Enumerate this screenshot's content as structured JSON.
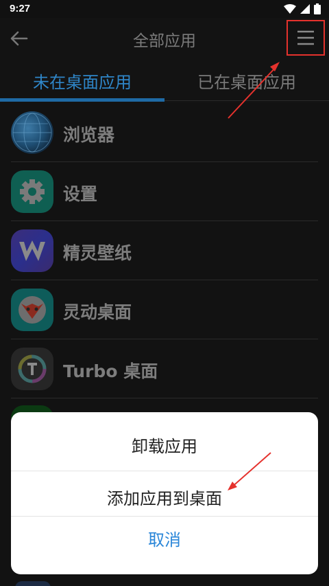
{
  "status_bar": {
    "time": "9:27"
  },
  "app_bar": {
    "title": "全部应用"
  },
  "tabs": [
    {
      "label": "未在桌面应用",
      "active": true
    },
    {
      "label": "已在桌面应用",
      "active": false
    }
  ],
  "apps": [
    {
      "name": "浏览器",
      "icon": "browser-globe-icon"
    },
    {
      "name": "设置",
      "icon": "settings-gear-icon"
    },
    {
      "name": "精灵壁纸",
      "icon": "wallpaper-w-icon"
    },
    {
      "name": "灵动桌面",
      "icon": "fox-launcher-icon"
    },
    {
      "name": "Turbo 桌面",
      "icon": "turbo-t-icon"
    }
  ],
  "dialog": {
    "options": [
      "卸载应用",
      "添加应用到桌面"
    ],
    "cancel": "取消"
  },
  "colors": {
    "accent": "#2f86c8",
    "annotation_red": "#e5322d",
    "dialog_bg": "#ffffff",
    "background": "#121212"
  }
}
